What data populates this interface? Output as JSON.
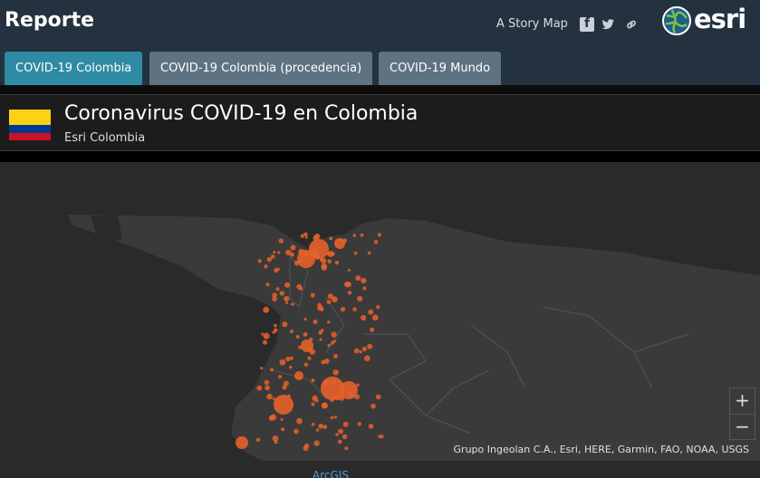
{
  "app": {
    "title": "Reporte",
    "story_map_label": "A Story Map",
    "share_icons": [
      "facebook-icon",
      "twitter-icon",
      "link-icon"
    ],
    "brand": "esri"
  },
  "tabs": [
    {
      "label": "COVID-19 Colombia",
      "active": true
    },
    {
      "label": "COVID-19 Colombia (procedencia)",
      "active": false
    },
    {
      "label": "COVID-19 Mundo",
      "active": false
    }
  ],
  "header": {
    "title": "Coronavirus COVID-19 en Colombia",
    "subtitle": "Esri Colombia",
    "flag_colors": [
      "#fcd116",
      "#003893",
      "#ce1126"
    ]
  },
  "map": {
    "zoom_in": "+",
    "zoom_out": "−",
    "attribution": "Grupo Ingeolan C.A., Esri, HERE, Garmin, FAO, NOAA, USGS",
    "point_color": "#e8622a",
    "footer_link": "ArcGIS"
  },
  "colors": {
    "topbar": "#243240",
    "active_tab": "#2e8ba3",
    "inactive_tab": "#5f7282"
  }
}
